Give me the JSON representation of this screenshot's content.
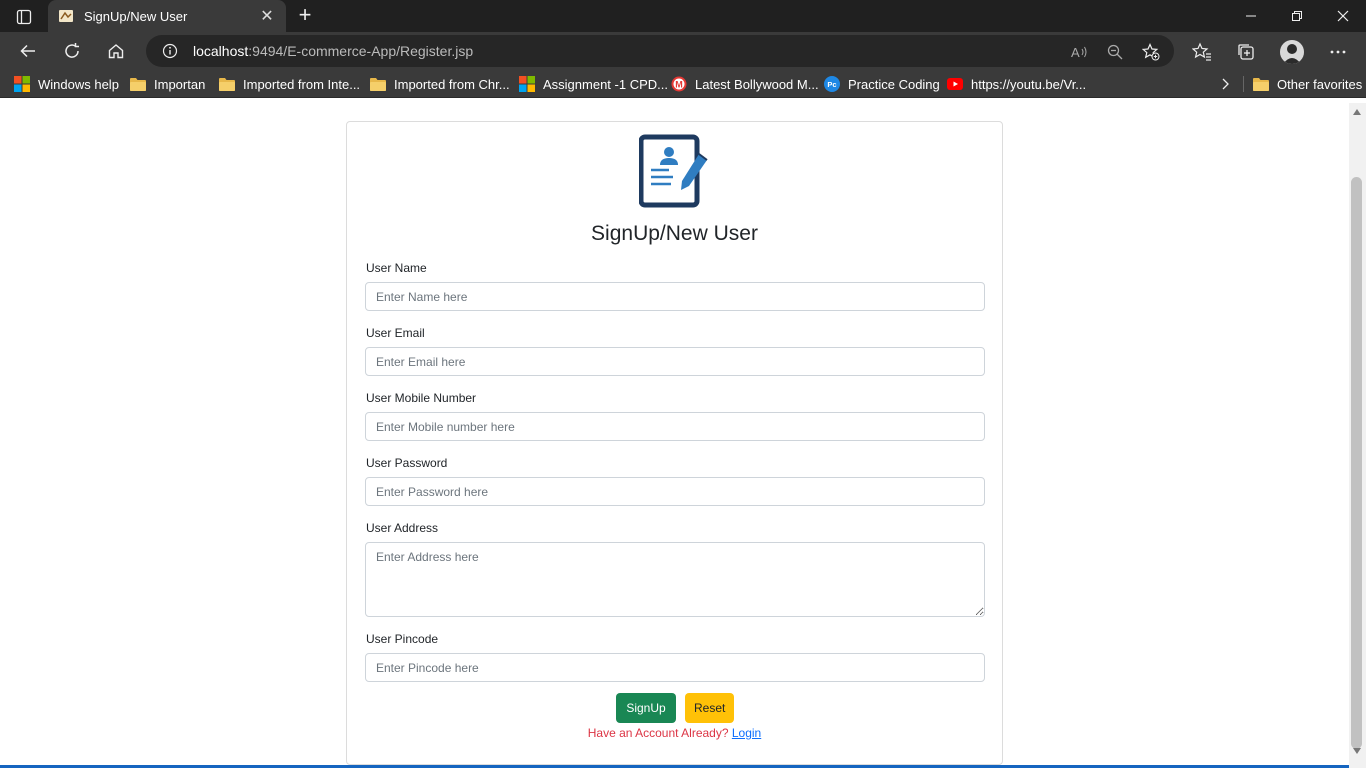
{
  "browser": {
    "tab_title": "SignUp/New User",
    "url_host": "localhost",
    "url_rest": ":9494/E-commerce-App/Register.jsp",
    "bookmarks": [
      {
        "label": "Windows help",
        "icon": "windows-logo-icon"
      },
      {
        "label": "Importan",
        "icon": "folder-icon"
      },
      {
        "label": "Imported from Inte...",
        "icon": "folder-icon"
      },
      {
        "label": "Imported from Chr...",
        "icon": "folder-icon"
      },
      {
        "label": "Assignment -1 CPD...",
        "icon": "microsoft-logo-icon"
      },
      {
        "label": "Latest Bollywood M...",
        "icon": "m-logo-icon"
      },
      {
        "label": "Practice Coding",
        "icon": "pc-logo-icon"
      },
      {
        "label": "https://youtu.be/Vr...",
        "icon": "youtube-icon"
      }
    ],
    "other_favorites": "Other favorites"
  },
  "form": {
    "title": "SignUp/New User",
    "fields": [
      {
        "label": "User Name",
        "placeholder": "Enter Name here"
      },
      {
        "label": "User Email",
        "placeholder": "Enter Email here"
      },
      {
        "label": "User Mobile Number",
        "placeholder": "Enter Mobile number here"
      },
      {
        "label": "User Password",
        "placeholder": "Enter Password here"
      },
      {
        "label": "User Address",
        "placeholder": "Enter Address here"
      },
      {
        "label": "User Pincode",
        "placeholder": "Enter Pincode here"
      }
    ],
    "signup_label": "SignUp",
    "reset_label": "Reset",
    "have_account_text": "Have an Account Already?",
    "login_link": "Login"
  },
  "colors": {
    "signup_button": "#198754",
    "reset_button": "#ffc107",
    "have_account_text": "#dc3545",
    "login_link": "#0d6efd",
    "logo_dark": "#1e3a5f",
    "logo_blue": "#2f7dc1"
  }
}
